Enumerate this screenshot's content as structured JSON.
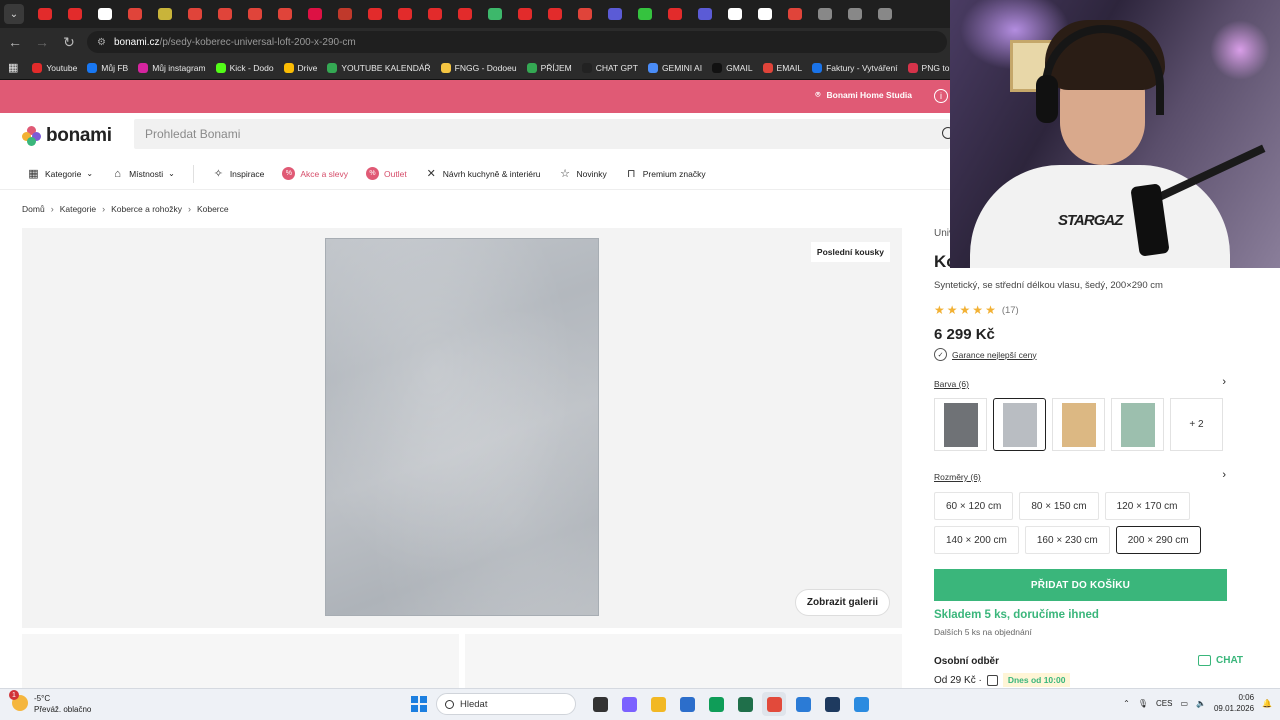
{
  "browser": {
    "tab_favicon_colors": [
      "#e22b2b",
      "#e22b2b",
      "#ffffff",
      "#e0443a",
      "#c9b43a",
      "#e0443a",
      "#e0443a",
      "#e0443a",
      "#e0443a",
      "#d14",
      "#c0392b",
      "#e22b2b",
      "#e22b2b",
      "#e22b2b",
      "#e22b2b",
      "#3db86b",
      "#e22b2b",
      "#e22b2b",
      "#e0443a",
      "#5b5bd6",
      "#35c33f",
      "#e22b2b",
      "#5b5bd6",
      "#ffffff",
      "#ffffff",
      "#e0443a",
      "#888",
      "#888",
      "#888"
    ],
    "url_host": "bonami.cz",
    "url_path": "/p/sedy-koberec-universal-loft-200-x-290-cm",
    "bookmarks": [
      {
        "label": "Youtube",
        "color": "#e22b2b"
      },
      {
        "label": "Můj FB",
        "color": "#1877f2"
      },
      {
        "label": "Můj instagram",
        "color": "#d6249f"
      },
      {
        "label": "Kick - Dodo",
        "color": "#53fc18"
      },
      {
        "label": "Drive",
        "color": "#fbbc04"
      },
      {
        "label": "YOUTUBE KALENDÁŘ",
        "color": "#34a853"
      },
      {
        "label": "FNGG - Dodoeu",
        "color": "#f5c542"
      },
      {
        "label": "PŘÍJEM",
        "color": "#34a853"
      },
      {
        "label": "CHAT GPT",
        "color": "#222222"
      },
      {
        "label": "GEMINI AI",
        "color": "#4a8cf7"
      },
      {
        "label": "GMAIL",
        "color": "#111111"
      },
      {
        "label": "EMAIL",
        "color": "#e0443a"
      },
      {
        "label": "Faktury - Vytváření",
        "color": "#1a73e8"
      },
      {
        "label": "PNG to PD",
        "color": "#d6334a"
      }
    ]
  },
  "promo": {
    "studio_label": "Bonami Home Studia",
    "info_label": "i"
  },
  "header": {
    "logo_text": "bonami",
    "search_placeholder": "Prohledat Bonami"
  },
  "catnav": {
    "items": [
      {
        "label": "Kategorie",
        "icon": "grid-icon",
        "dropdown": true
      },
      {
        "label": "Místnosti",
        "icon": "house-icon",
        "dropdown": true
      },
      {
        "label": "Inspirace",
        "icon": "bulb-icon"
      },
      {
        "label": "Akce a slevy",
        "icon": "percent-icon",
        "sale": true
      },
      {
        "label": "Outlet",
        "icon": "percent-icon",
        "sale": true
      },
      {
        "label": "Návrh kuchyně & interiéru",
        "icon": "tools-icon"
      },
      {
        "label": "Novinky",
        "icon": "star-icon"
      },
      {
        "label": "Premium značky",
        "icon": "bookmark-icon"
      }
    ]
  },
  "breadcrumb": [
    "Domů",
    "Kategorie",
    "Koberce a rohožky",
    "Koberce"
  ],
  "gallery": {
    "badge": "Poslední kousky",
    "button": "Zobrazit galerii"
  },
  "product": {
    "brand": "Univ",
    "title": "Ko",
    "subtitle": "Syntetický, se střední délkou vlasu, šedý, 200×290 cm",
    "rating": 5,
    "review_count": "(17)",
    "price": "6 299 Kč",
    "guarantee": "Garance nejlepší ceny",
    "color_label": "Barva (6)",
    "colors": [
      {
        "swatch": "#6f7276"
      },
      {
        "swatch": "#b9bdc2",
        "selected": true
      },
      {
        "swatch": "#dcb883"
      },
      {
        "swatch": "#9cbfae"
      }
    ],
    "more_colors": "+ 2",
    "size_label": "Rozměry (6)",
    "sizes": [
      {
        "label": "60 × 120 cm"
      },
      {
        "label": "80 × 150 cm"
      },
      {
        "label": "120 × 170 cm"
      },
      {
        "label": "140 × 200 cm"
      },
      {
        "label": "160 × 230 cm"
      },
      {
        "label": "200 × 290 cm",
        "selected": true
      }
    ],
    "cart_button": "PŘIDAT DO KOŠÍKU",
    "stock": "Skladem 5 ks, doručíme ihned",
    "stock_note": "Dalších 5 ks na objednání",
    "pickup_title": "Osobní odběr",
    "pickup_price": "Od 29 Kč ·",
    "pickup_when": "Dnes od 10:00"
  },
  "chat_label": "CHAT",
  "webcam": {
    "shirt_print": "STARGAZ"
  },
  "taskbar": {
    "weather_badge": "1",
    "temperature": "-5°C",
    "condition": "Převáž. oblačno",
    "search_label": "Hledat",
    "apps": [
      {
        "color": "#333333"
      },
      {
        "color": "#7b61ff"
      },
      {
        "color": "#f2b824"
      },
      {
        "color": "#2c6ecb"
      },
      {
        "color": "#0f9d58"
      },
      {
        "color": "#1f6f4a"
      },
      {
        "color": "#e24a3b",
        "active": true
      },
      {
        "color": "#2b7bd6"
      },
      {
        "color": "#1e3a5f"
      },
      {
        "color": "#2b8be0"
      }
    ],
    "language": "CES",
    "time": "0:06",
    "date": "09.01.2026"
  },
  "colors": {
    "promo": "#e05a75",
    "accent_green": "#3ab67b",
    "sale_pink": "#d64d6a"
  }
}
